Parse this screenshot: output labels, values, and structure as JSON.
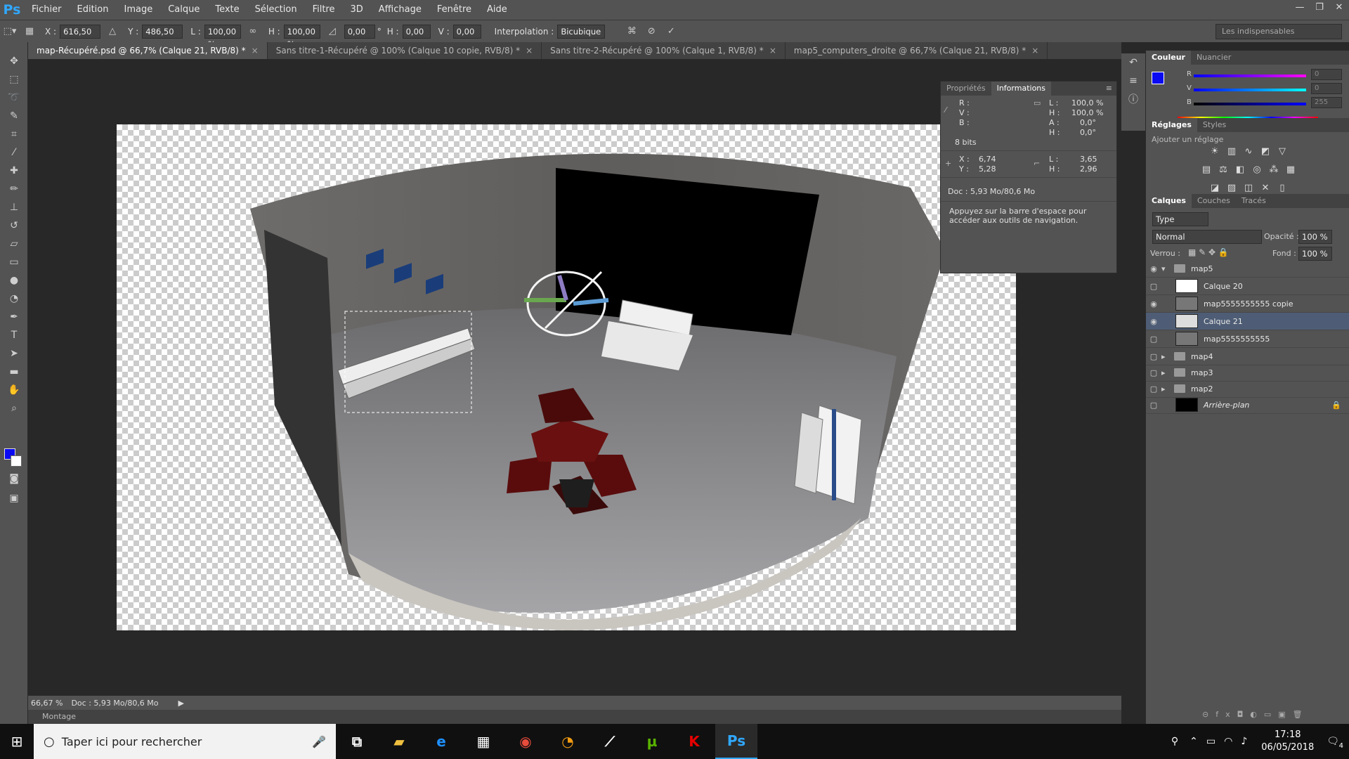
{
  "app": {
    "logo": "Ps"
  },
  "menu": [
    "Fichier",
    "Edition",
    "Image",
    "Calque",
    "Texte",
    "Sélection",
    "Filtre",
    "3D",
    "Affichage",
    "Fenêtre",
    "Aide"
  ],
  "options": {
    "x_label": "X :",
    "x_value": "616,50 px",
    "y_label": "Y :",
    "y_value": "486,50 px",
    "w_label": "L :",
    "w_value": "100,00 %",
    "h_label": "H :",
    "h_value": "100,00 %",
    "angle_value": "0,00",
    "angle_unit": "°",
    "hskew_label": "H :",
    "hskew_value": "0,00",
    "vskew_label": "V :",
    "vskew_value": "0,00",
    "interp_label": "Interpolation :",
    "interp_value": "Bicubique",
    "workspace": "Les indispensables"
  },
  "tabs": [
    {
      "label": "map-Récupéré.psd @ 66,7% (Calque 21, RVB/8) *",
      "active": true
    },
    {
      "label": "Sans titre-1-Récupéré @ 100% (Calque 10 copie, RVB/8) *",
      "active": false
    },
    {
      "label": "Sans titre-2-Récupéré @ 100% (Calque 1, RVB/8) *",
      "active": false
    },
    {
      "label": "map5_computers_droite @ 66,7% (Calque 21, RVB/8) *",
      "active": false
    }
  ],
  "info": {
    "tab_props": "Propriétés",
    "tab_info": "Informations",
    "r": "R :",
    "v": "V :",
    "b": "B :",
    "bits": "8 bits",
    "l_label": "L :",
    "l_value": "100,0 %",
    "h_label": "H :",
    "h_value": "100,0 %",
    "a_label": "A :",
    "a_value": "0,0°",
    "h2_label": "H :",
    "h2_value": "0,0°",
    "x_label": "X :",
    "x_value": "6,74",
    "y_label": "Y :",
    "y_value": "5,28",
    "w_label": "L :",
    "w_value": "3,65",
    "hh_label": "H :",
    "hh_value": "2,96",
    "doc": "Doc : 5,93 Mo/80,6 Mo",
    "hint": "Appuyez sur la barre d'espace pour accéder aux outils de navigation."
  },
  "status": {
    "zoom": "66,67 %",
    "doc": "Doc : 5,93 Mo/80,6 Mo",
    "montage": "Montage"
  },
  "color_panel": {
    "tab1": "Couleur",
    "tab2": "Nuancier",
    "r_label": "R",
    "v_label": "V",
    "b_label": "B",
    "r_value": "0",
    "v_value": "0",
    "b_value": "255"
  },
  "adjust_panel": {
    "tab1": "Réglages",
    "tab2": "Styles",
    "title": "Ajouter un réglage"
  },
  "layers_panel": {
    "tab1": "Calques",
    "tab2": "Couches",
    "tab3": "Tracés",
    "filter": "Type",
    "blend_mode": "Normal",
    "opacity_label": "Opacité :",
    "opacity_value": "100 %",
    "lock_label": "Verrou :",
    "fill_label": "Fond :",
    "fill_value": "100 %",
    "layers": [
      {
        "name": "map5",
        "type": "group",
        "visible": true,
        "open": true
      },
      {
        "name": "Calque 20",
        "type": "layer",
        "visible": false
      },
      {
        "name": "map5555555555 copie",
        "type": "layer",
        "visible": true
      },
      {
        "name": "Calque 21",
        "type": "layer",
        "visible": true,
        "selected": true
      },
      {
        "name": "map5555555555",
        "type": "layer",
        "visible": false
      },
      {
        "name": "map4",
        "type": "group",
        "visible": false
      },
      {
        "name": "map3",
        "type": "group",
        "visible": false
      },
      {
        "name": "map2",
        "type": "group",
        "visible": false
      },
      {
        "name": "Arrière-plan",
        "type": "background",
        "visible": false
      }
    ]
  },
  "taskbar": {
    "search_placeholder": "Taper ici pour rechercher",
    "time": "17:18",
    "date": "06/05/2018",
    "notif_count": "4",
    "apps": [
      "task-view",
      "file-explorer",
      "edge",
      "store",
      "chrome",
      "blender",
      "unknown-app",
      "utorrent",
      "kaspersky",
      "photoshop"
    ]
  },
  "colors": {
    "foreground": "#0a0af2",
    "background": "#ffffff",
    "selection": "#4e5d75"
  }
}
